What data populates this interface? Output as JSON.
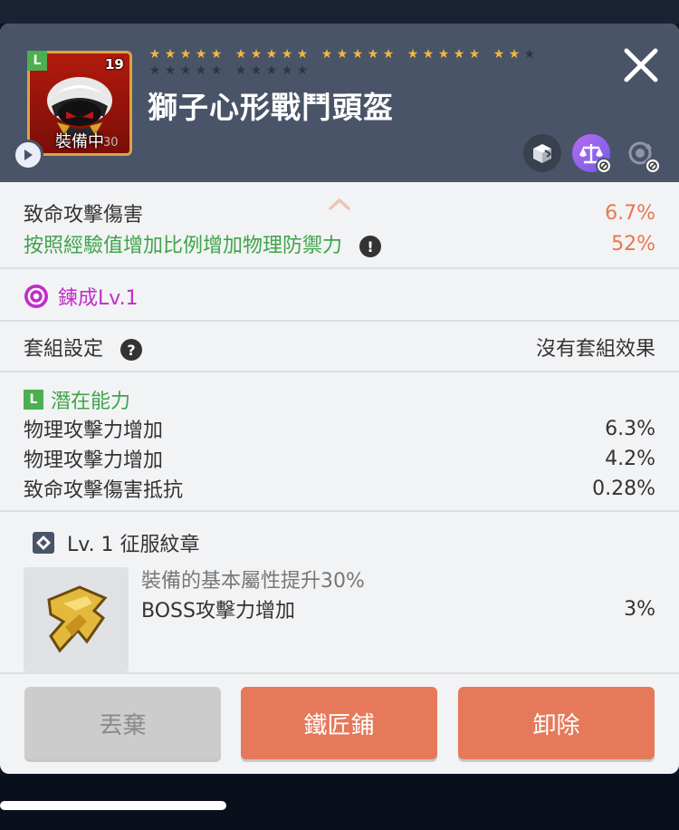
{
  "item": {
    "name": "獅子心形戰鬥頭盔",
    "potential_grade": "L",
    "upgrade_count": "19",
    "equipped_label": "裝備中",
    "durability": "30",
    "stars_filled": 22,
    "stars_total": 25
  },
  "stats": {
    "line1": {
      "label": "致命攻擊傷害",
      "value": "6.7%"
    },
    "line2": {
      "label": "按照經驗值增加比例增加物理防禦力",
      "value": "52%"
    }
  },
  "refine": {
    "label": "鍊成Lv.1"
  },
  "set": {
    "label": "套組設定",
    "value": "沒有套組效果"
  },
  "potential": {
    "grade": "L",
    "title": "潛在能力",
    "lines": [
      {
        "label": "物理攻擊力增加",
        "value": "6.3%"
      },
      {
        "label": "物理攻擊力增加",
        "value": "4.2%"
      },
      {
        "label": "致命攻擊傷害抵抗",
        "value": "0.28%"
      }
    ]
  },
  "emblem": {
    "title": "Lv. 1 征服紋章",
    "desc": "裝備的基本屬性提升30%",
    "line": {
      "label": "BOSS攻擊力增加",
      "value": "3%"
    }
  },
  "buttons": {
    "discard": "丟棄",
    "blacksmith": "鐵匠鋪",
    "unequip": "卸除"
  },
  "colors": {
    "header_bg": "#4a5468",
    "accent_orange": "#e5795a",
    "stat_green": "#3fa44a",
    "refine_magenta": "#c02ec8"
  }
}
